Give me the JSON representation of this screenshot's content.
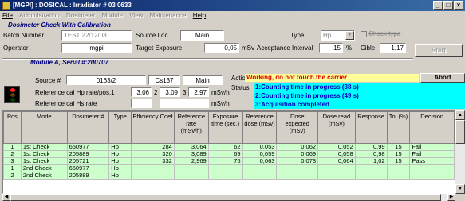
{
  "window": {
    "title": "[MGPI] : DOSICAL : Irradiator # 03 0633"
  },
  "menu": [
    "File",
    "Administration",
    "Dosimeter",
    "Module",
    "View",
    "Maintenance",
    "Help"
  ],
  "section_title": "Dosimeter Check With Calibration",
  "batch": {
    "label": "Batch Number",
    "value": "TEST 22/12/03"
  },
  "source_loc": {
    "label": "Source Loc",
    "value": "Main"
  },
  "type": {
    "label": "Type",
    "value": "Hp"
  },
  "check_type": {
    "label": "Check type"
  },
  "operator": {
    "label": "Operator",
    "value": "mgpi"
  },
  "target": {
    "label": "Target Exposure",
    "value": "0,05",
    "unit": "mSv"
  },
  "acceptance": {
    "label": "Acceptance Interval",
    "value": "15",
    "unit": "%"
  },
  "cible": {
    "label": "Cible",
    "value": "1,17"
  },
  "start_button": "Start",
  "module_title": "Module A, Serial #:200707",
  "source": {
    "label": "Source #",
    "value": "0163/2",
    "nuclide": "Cs137",
    "loc": "Main"
  },
  "ref_hp": {
    "label": "Reference cal Hp rate/pos.1",
    "v1": "3,06",
    "p2": "2",
    "v2": "3,09",
    "p3": "3",
    "v3": "2,97",
    "unit": "mSv/h"
  },
  "ref_hs": {
    "label": "Reference cal Hs rate",
    "unit": "mSv/h"
  },
  "action": {
    "label": "Action",
    "value": "Working, do not touch the carrier"
  },
  "abort_button": "Abort",
  "status": {
    "label": "Status",
    "lines": [
      "1:Counting time in progress (38 s)",
      "2:Counting time in progress (49 s)",
      "3:Acquisition completed"
    ]
  },
  "table": {
    "headers": [
      "Pos",
      "Mode",
      "Dosimeter #",
      "Type",
      "Efficiency Coef",
      "Reference rate (mSv/h)",
      "Exposure time (sec.)",
      "Reference dose (mSv)",
      "Dose expected (mSv)",
      "Dose read (mSv)",
      "Response",
      "Tol (%)",
      "Decision"
    ],
    "rows": [
      [
        "1",
        "1st Check",
        "650977",
        "Hp",
        "284",
        "3,064",
        "62",
        "0,053",
        "0,062",
        "0,052",
        "0,99",
        "15",
        "Fail"
      ],
      [
        "2",
        "1st Check",
        "205889",
        "Hp",
        "320",
        "3,089",
        "69",
        "0,059",
        "0,069",
        "0,058",
        "0,98",
        "15",
        "Fail"
      ],
      [
        "3",
        "1st Check",
        "205721",
        "Hp",
        "332",
        "2,969",
        "76",
        "0,063",
        "0,073",
        "0,064",
        "1,02",
        "15",
        "Pass"
      ],
      [
        "1",
        "2nd Check",
        "650977",
        "Hp",
        "",
        "",
        "",
        "",
        "",
        "",
        "",
        "",
        ""
      ],
      [
        "2",
        "2nd Check",
        "205889",
        "Hp",
        "",
        "",
        "",
        "",
        "",
        "",
        "",
        "",
        ""
      ]
    ]
  }
}
